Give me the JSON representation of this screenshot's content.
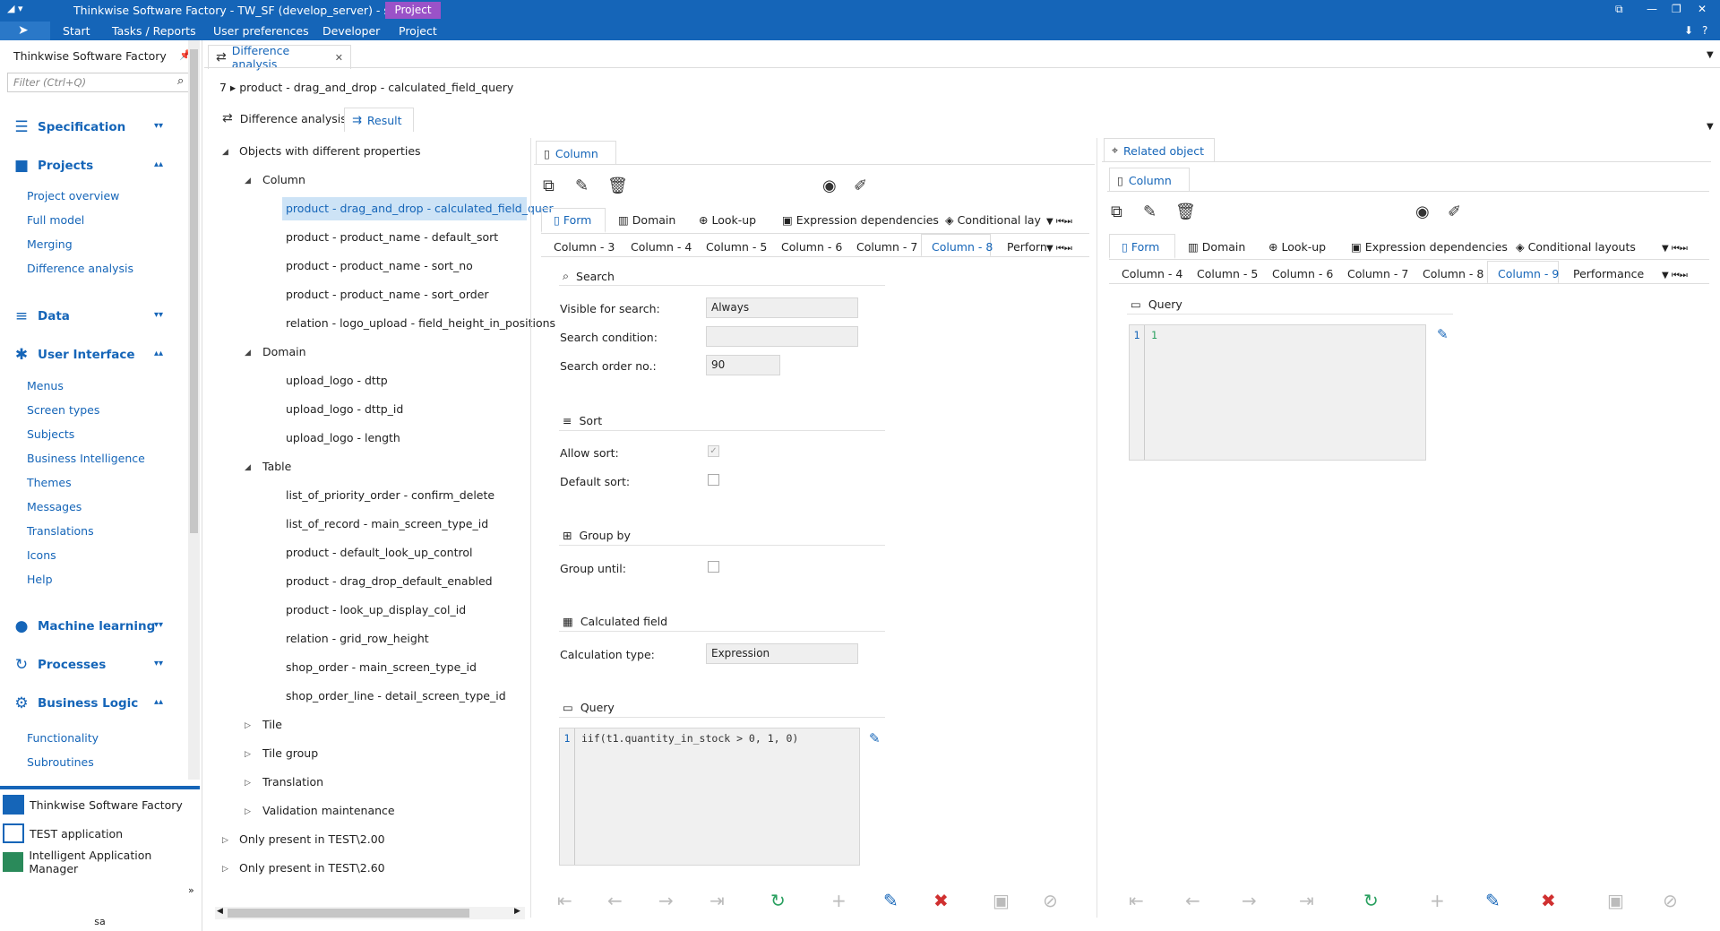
{
  "titlebar": {
    "title": "Thinkwise Software Factory - TW_SF (develop_server) - sa",
    "context_tab": "Project",
    "menus": [
      "Start",
      "Tasks / Reports",
      "User preferences",
      "Developer",
      "Project"
    ]
  },
  "sidebar": {
    "title": "Thinkwise Software Factory",
    "filter_placeholder": "Filter (Ctrl+Q)",
    "groups": [
      {
        "label": "Specification"
      },
      {
        "label": "Projects",
        "items": [
          "Project overview",
          "Full model",
          "Merging",
          "Difference analysis"
        ]
      },
      {
        "label": "Data"
      },
      {
        "label": "User Interface",
        "items": [
          "Menus",
          "Screen types",
          "Subjects",
          "Business Intelligence",
          "Themes",
          "Messages",
          "Translations",
          "Icons",
          "Help"
        ]
      },
      {
        "label": "Machine learning"
      },
      {
        "label": "Processes"
      },
      {
        "label": "Business Logic",
        "items": [
          "Functionality",
          "Subroutines"
        ]
      }
    ],
    "apps": [
      "Thinkwise Software Factory",
      "TEST application",
      "Intelligent Application Manager"
    ],
    "user": "sa"
  },
  "doc_tab": "Difference analysis",
  "breadcrumb": {
    "count": "7",
    "path": "product - drag_and_drop - calculated_field_query"
  },
  "inner_tabs": [
    "Difference analysis",
    "Result"
  ],
  "tree": {
    "root": "Objects with different properties",
    "column_group": "Column",
    "columns": [
      "product - drag_and_drop - calculated_field_quer",
      "product - product_name - default_sort",
      "product - product_name - sort_no",
      "product - product_name - sort_order",
      "relation - logo_upload - field_height_in_positions"
    ],
    "domain_group": "Domain",
    "domains": [
      "upload_logo - dttp",
      "upload_logo - dttp_id",
      "upload_logo - length"
    ],
    "table_group": "Table",
    "tables": [
      "list_of_priority_order - confirm_delete",
      "list_of_record - main_screen_type_id",
      "product - default_look_up_control",
      "product - drag_drop_default_enabled",
      "product - look_up_display_col_id",
      "relation - grid_row_height",
      "shop_order - main_screen_type_id",
      "shop_order_line - detail_screen_type_id"
    ],
    "collapsed": [
      "Tile",
      "Tile group",
      "Translation",
      "Validation maintenance"
    ],
    "only1": "Only present in TEST\\2.00",
    "only2": "Only present in TEST\\2.60"
  },
  "left_panel": {
    "tab": "Column",
    "subtabs": [
      "Form",
      "Domain",
      "Look-up",
      "Expression dependencies",
      "Conditional lay"
    ],
    "coltabs": [
      "Column - 3",
      "Column - 4",
      "Column - 5",
      "Column - 6",
      "Column - 7",
      "Column - 8",
      "Perforn"
    ],
    "search_section": "Search",
    "visible_for_search_label": "Visible for search:",
    "visible_for_search": "Always",
    "search_condition_label": "Search condition:",
    "search_order_label": "Search order no.:",
    "search_order": "90",
    "sort_section": "Sort",
    "allow_sort_label": "Allow sort:",
    "default_sort_label": "Default sort:",
    "group_section": "Group by",
    "group_until_label": "Group until:",
    "calc_section": "Calculated field",
    "calc_type_label": "Calculation type:",
    "calc_type": "Expression",
    "query_section": "Query",
    "query_line": "1",
    "query": "iif(t1.quantity_in_stock > 0, 1, 0)"
  },
  "right_panel": {
    "tab": "Related object",
    "subtab": "Column",
    "subtabs": [
      "Form",
      "Domain",
      "Look-up",
      "Expression dependencies",
      "Conditional layouts"
    ],
    "coltabs": [
      "Column - 4",
      "Column - 5",
      "Column - 6",
      "Column - 7",
      "Column - 8",
      "Column - 9",
      "Performance"
    ],
    "query_section": "Query",
    "query_line": "1",
    "query": "1"
  },
  "colors": {
    "brand": "#1565b8",
    "context": "#9a52c8",
    "refresh": "#2aa060",
    "delete": "#d03030"
  }
}
